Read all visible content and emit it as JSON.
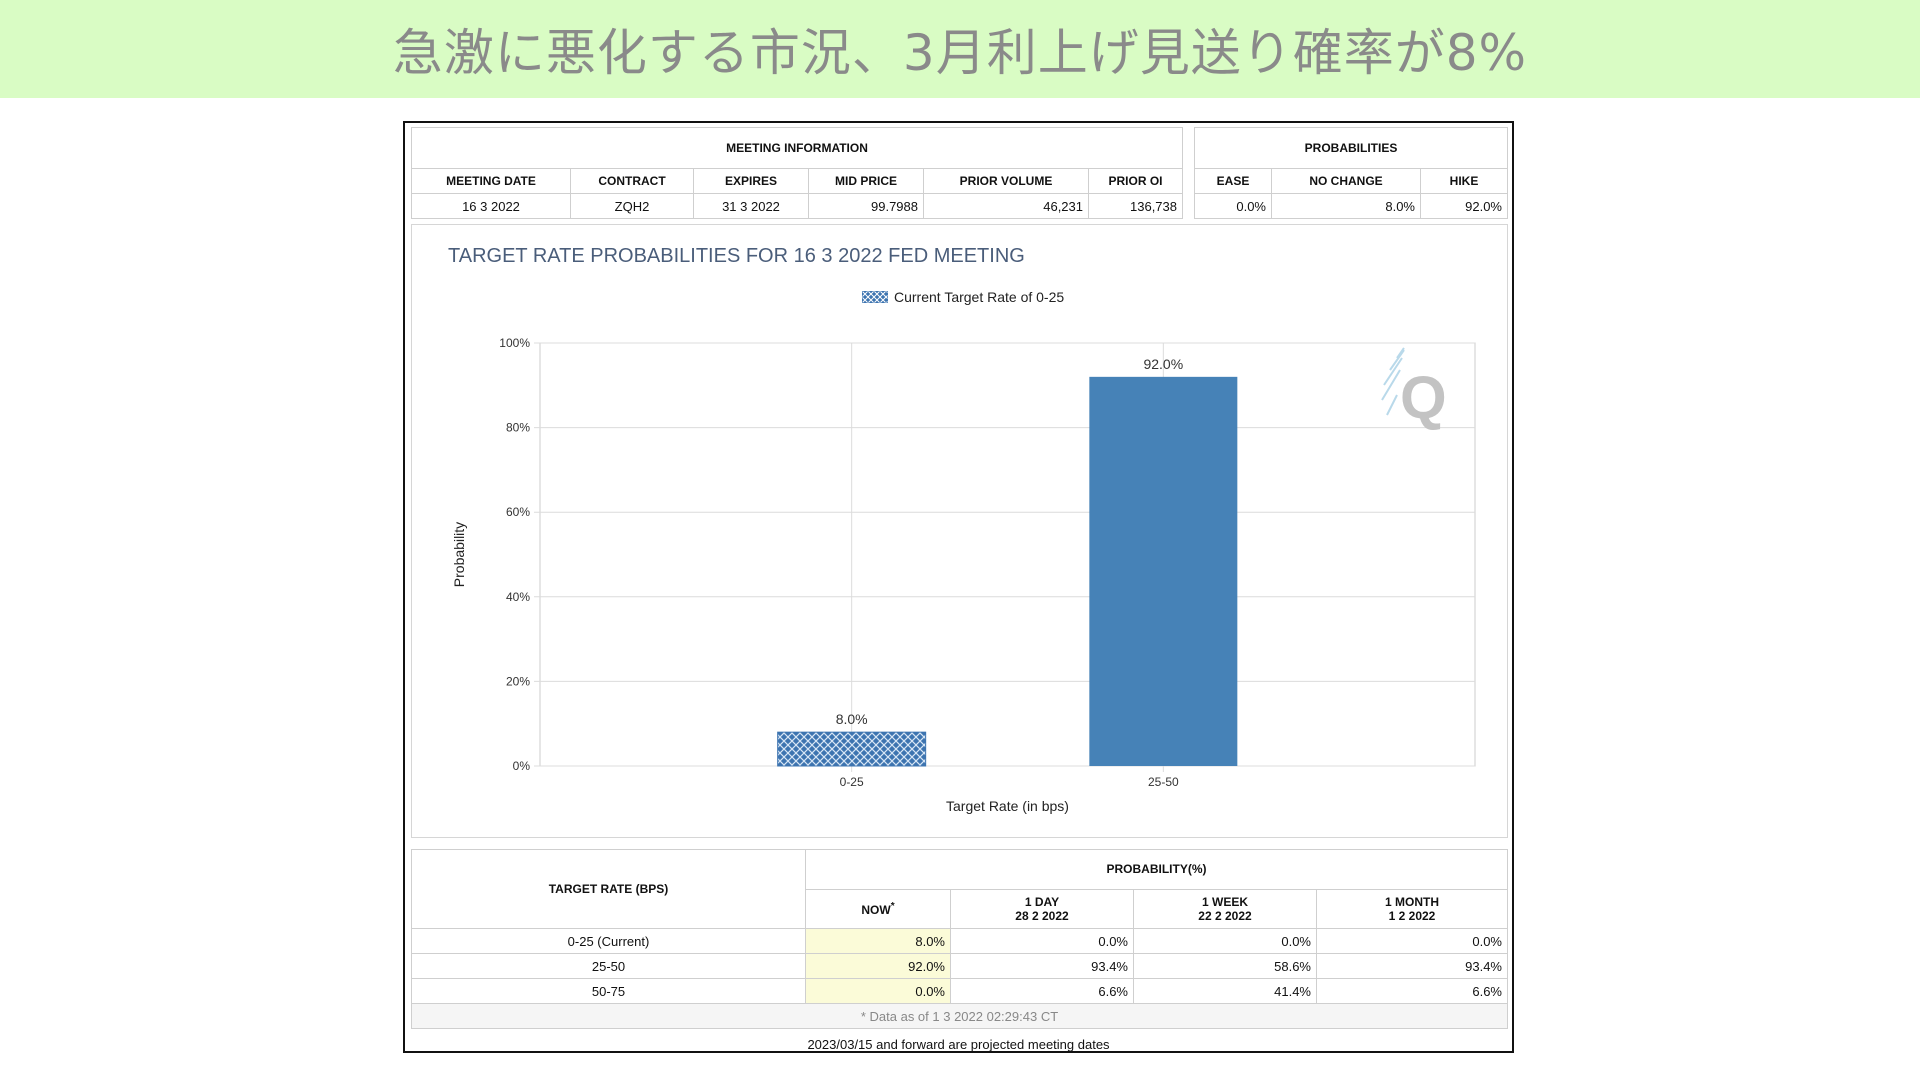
{
  "banner": {
    "title": "急激に悪化する市況、3月利上げ見送り確率が8%"
  },
  "meeting_info": {
    "group_label": "MEETING INFORMATION",
    "headers": [
      "MEETING DATE",
      "CONTRACT",
      "EXPIRES",
      "MID PRICE",
      "PRIOR VOLUME",
      "PRIOR OI"
    ],
    "values": [
      "16 3 2022",
      "ZQH2",
      "31 3 2022",
      "99.7988",
      "46,231",
      "136,738"
    ]
  },
  "probabilities": {
    "group_label": "PROBABILITIES",
    "headers": [
      "EASE",
      "NO CHANGE",
      "HIKE"
    ],
    "values": [
      "0.0%",
      "8.0%",
      "92.0%"
    ]
  },
  "chart_data": {
    "type": "bar",
    "title": "TARGET RATE PROBABILITIES FOR 16 3 2022 FED MEETING",
    "legend": "Current Target Rate of 0-25",
    "legend_placement": "top-center",
    "categories": [
      "0-25",
      "25-50"
    ],
    "values": [
      8.0,
      92.0
    ],
    "data_labels": [
      "8.0%",
      "92.0%"
    ],
    "xlabel": "Target Rate (in bps)",
    "ylabel": "Probability",
    "ylim": [
      0,
      100
    ],
    "yticks": [
      "0%",
      "20%",
      "40%",
      "60%",
      "80%",
      "100%"
    ],
    "grid": true,
    "colors": {
      "current": "#3d74b0",
      "bar": "#4682b7"
    }
  },
  "prob_table": {
    "rate_header": "TARGET RATE (BPS)",
    "group_header": "PROBABILITY(%)",
    "columns": [
      {
        "line1": "NOW",
        "line2": ""
      },
      {
        "line1": "1 DAY",
        "line2": "28 2 2022"
      },
      {
        "line1": "1 WEEK",
        "line2": "22 2 2022"
      },
      {
        "line1": "1 MONTH",
        "line2": "1 2 2022"
      }
    ],
    "now_marker": "*",
    "rows": [
      {
        "rate": "0-25 (Current)",
        "values": [
          "8.0%",
          "0.0%",
          "0.0%",
          "0.0%"
        ]
      },
      {
        "rate": "25-50",
        "values": [
          "92.0%",
          "93.4%",
          "58.6%",
          "93.4%"
        ]
      },
      {
        "rate": "50-75",
        "values": [
          "0.0%",
          "6.6%",
          "41.4%",
          "6.6%"
        ]
      }
    ],
    "note": "* Data as of 1 3 2022 02:29:43 CT"
  },
  "footer": {
    "text": "2023/03/15 and forward are projected meeting dates"
  }
}
